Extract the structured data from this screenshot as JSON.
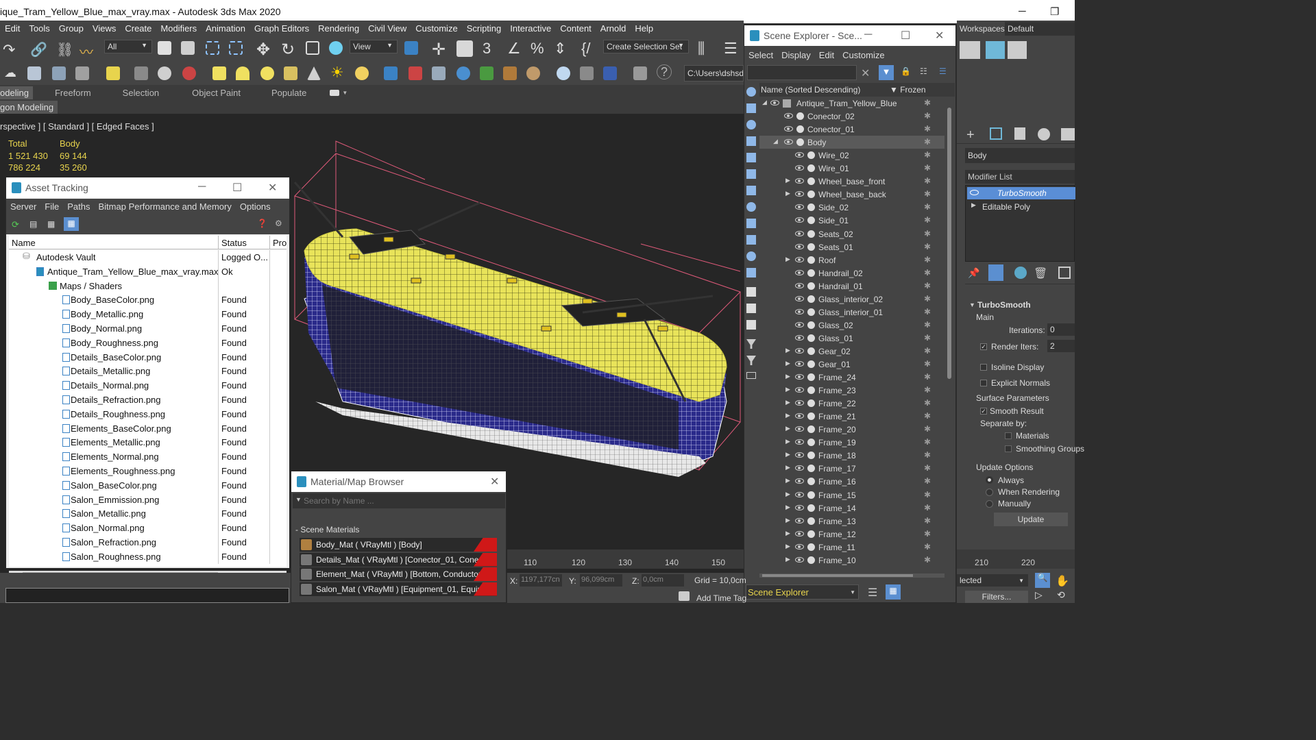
{
  "title_bar": {
    "title": "ique_Tram_Yellow_Blue_max_vray.max - Autodesk 3ds Max 2020"
  },
  "main_menu": [
    "Edit",
    "Tools",
    "Group",
    "Views",
    "Create",
    "Modifiers",
    "Animation",
    "Graph Editors",
    "Rendering",
    "Civil View",
    "Customize",
    "Scripting",
    "Interactive",
    "Content",
    "Arnold",
    "Help"
  ],
  "toolbar": {
    "filter_select": "All",
    "view_select": "View",
    "angle_snap": "3",
    "selection_set": "Create Selection Set",
    "path": "C:\\Users\\dshsd\\"
  },
  "ribbon": {
    "tabs": [
      "odeling",
      "Freeform",
      "Selection",
      "Object Paint",
      "Populate"
    ],
    "sub": "gon Modeling"
  },
  "viewport": {
    "label": "rspective ] [ Standard ] [ Edged Faces ]",
    "stats": {
      "h1": "Total",
      "h2": "Body",
      "r1c1": "1 521 430",
      "r1c2": "69 144",
      "r2c1": "786 224",
      "r2c2": "35 260"
    }
  },
  "asset_tracking": {
    "title": "Asset Tracking",
    "menu": [
      "Server",
      "File",
      "Paths",
      "Bitmap Performance and Memory",
      "Options"
    ],
    "columns": [
      "Name",
      "Status",
      "Pro"
    ],
    "rows": [
      {
        "name": "Autodesk Vault",
        "status": "Logged O..."
      },
      {
        "name": "Antique_Tram_Yellow_Blue_max_vray.max",
        "status": "Ok"
      },
      {
        "name": "Maps / Shaders",
        "status": ""
      },
      {
        "name": "Body_BaseColor.png",
        "status": "Found"
      },
      {
        "name": "Body_Metallic.png",
        "status": "Found"
      },
      {
        "name": "Body_Normal.png",
        "status": "Found"
      },
      {
        "name": "Body_Roughness.png",
        "status": "Found"
      },
      {
        "name": "Details_BaseColor.png",
        "status": "Found"
      },
      {
        "name": "Details_Metallic.png",
        "status": "Found"
      },
      {
        "name": "Details_Normal.png",
        "status": "Found"
      },
      {
        "name": "Details_Refraction.png",
        "status": "Found"
      },
      {
        "name": "Details_Roughness.png",
        "status": "Found"
      },
      {
        "name": "Elements_BaseColor.png",
        "status": "Found"
      },
      {
        "name": "Elements_Metallic.png",
        "status": "Found"
      },
      {
        "name": "Elements_Normal.png",
        "status": "Found"
      },
      {
        "name": "Elements_Roughness.png",
        "status": "Found"
      },
      {
        "name": "Salon_BaseColor.png",
        "status": "Found"
      },
      {
        "name": "Salon_Emmission.png",
        "status": "Found"
      },
      {
        "name": "Salon_Metallic.png",
        "status": "Found"
      },
      {
        "name": "Salon_Normal.png",
        "status": "Found"
      },
      {
        "name": "Salon_Refraction.png",
        "status": "Found"
      },
      {
        "name": "Salon_Roughness.png",
        "status": "Found"
      }
    ]
  },
  "material_browser": {
    "title": "Material/Map Browser",
    "search_placeholder": "Search by Name ...",
    "section": "- Scene Materials",
    "materials": [
      "Body_Mat  ( VRayMtl )  [Body]",
      "Details_Mat  ( VRayMtl )  [Conector_01, Conecto...",
      "Element_Mat  ( VRayMtl )  [Bottom, Conductor_...",
      "Salon_Mat  ( VRayMtl )  [Equipment_01, Equipm..."
    ]
  },
  "scene_explorer": {
    "title": "Scene Explorer - Sce...",
    "menu": [
      "Select",
      "Display",
      "Edit",
      "Customize"
    ],
    "col_name": "Name (Sorted Descending)",
    "col_frozen": "▼ Frozen",
    "footer_label": "Scene Explorer",
    "items": [
      {
        "name": "Antique_Tram_Yellow_Blue",
        "lvl": 0,
        "exp": "open"
      },
      {
        "name": "Conector_02",
        "lvl": 1,
        "exp": ""
      },
      {
        "name": "Conector_01",
        "lvl": 1,
        "exp": ""
      },
      {
        "name": "Body",
        "lvl": 1,
        "exp": "open",
        "sel": true
      },
      {
        "name": "Wire_02",
        "lvl": 2,
        "exp": ""
      },
      {
        "name": "Wire_01",
        "lvl": 2,
        "exp": ""
      },
      {
        "name": "Wheel_base_front",
        "lvl": 2,
        "exp": "closed"
      },
      {
        "name": "Wheel_base_back",
        "lvl": 2,
        "exp": "closed"
      },
      {
        "name": "Side_02",
        "lvl": 2,
        "exp": ""
      },
      {
        "name": "Side_01",
        "lvl": 2,
        "exp": ""
      },
      {
        "name": "Seats_02",
        "lvl": 2,
        "exp": ""
      },
      {
        "name": "Seats_01",
        "lvl": 2,
        "exp": ""
      },
      {
        "name": "Roof",
        "lvl": 2,
        "exp": "closed"
      },
      {
        "name": "Handrail_02",
        "lvl": 2,
        "exp": ""
      },
      {
        "name": "Handrail_01",
        "lvl": 2,
        "exp": ""
      },
      {
        "name": "Glass_interior_02",
        "lvl": 2,
        "exp": ""
      },
      {
        "name": "Glass_interior_01",
        "lvl": 2,
        "exp": ""
      },
      {
        "name": "Glass_02",
        "lvl": 2,
        "exp": ""
      },
      {
        "name": "Glass_01",
        "lvl": 2,
        "exp": ""
      },
      {
        "name": "Gear_02",
        "lvl": 2,
        "exp": "closed"
      },
      {
        "name": "Gear_01",
        "lvl": 2,
        "exp": "closed"
      },
      {
        "name": "Frame_24",
        "lvl": 2,
        "exp": "closed"
      },
      {
        "name": "Frame_23",
        "lvl": 2,
        "exp": "closed"
      },
      {
        "name": "Frame_22",
        "lvl": 2,
        "exp": "closed"
      },
      {
        "name": "Frame_21",
        "lvl": 2,
        "exp": "closed"
      },
      {
        "name": "Frame_20",
        "lvl": 2,
        "exp": "closed"
      },
      {
        "name": "Frame_19",
        "lvl": 2,
        "exp": "closed"
      },
      {
        "name": "Frame_18",
        "lvl": 2,
        "exp": "closed"
      },
      {
        "name": "Frame_17",
        "lvl": 2,
        "exp": "closed"
      },
      {
        "name": "Frame_16",
        "lvl": 2,
        "exp": "closed"
      },
      {
        "name": "Frame_15",
        "lvl": 2,
        "exp": "closed"
      },
      {
        "name": "Frame_14",
        "lvl": 2,
        "exp": "closed"
      },
      {
        "name": "Frame_13",
        "lvl": 2,
        "exp": "closed"
      },
      {
        "name": "Frame_12",
        "lvl": 2,
        "exp": "closed"
      },
      {
        "name": "Frame_11",
        "lvl": 2,
        "exp": "closed"
      },
      {
        "name": "Frame_10",
        "lvl": 2,
        "exp": "closed"
      }
    ]
  },
  "command_panel": {
    "workspaces_label": "Workspaces:",
    "workspace": "Default",
    "object_name": "Body",
    "modifier_list": "Modifier List",
    "stack": [
      "TurboSmooth",
      "Editable Poly"
    ],
    "rollout": "TurboSmooth",
    "main": "Main",
    "iterations_label": "Iterations:",
    "iterations": "0",
    "render_iters_label": "Render Iters:",
    "render_iters": "2",
    "isoline": "Isoline Display",
    "explicit": "Explicit Normals",
    "surface": "Surface Parameters",
    "smooth_result": "Smooth Result",
    "separate": "Separate by:",
    "materials": "Materials",
    "smoothing": "Smoothing Groups",
    "update_options": "Update Options",
    "always": "Always",
    "when_rendering": "When Rendering",
    "manually": "Manually",
    "update_btn": "Update"
  },
  "status_bar": {
    "ticks": [
      "110",
      "120",
      "130",
      "140",
      "150"
    ],
    "ticks_right": [
      "210",
      "220"
    ],
    "x_label": "X:",
    "x_val": "1197,177cn",
    "y_label": "Y:",
    "y_val": "96,099cm",
    "z_label": "Z:",
    "z_val": "0,0cm",
    "grid": "Grid = 10,0cm",
    "add_time_tag": "Add Time Tag",
    "selected": "lected",
    "filters": "Filters..."
  }
}
